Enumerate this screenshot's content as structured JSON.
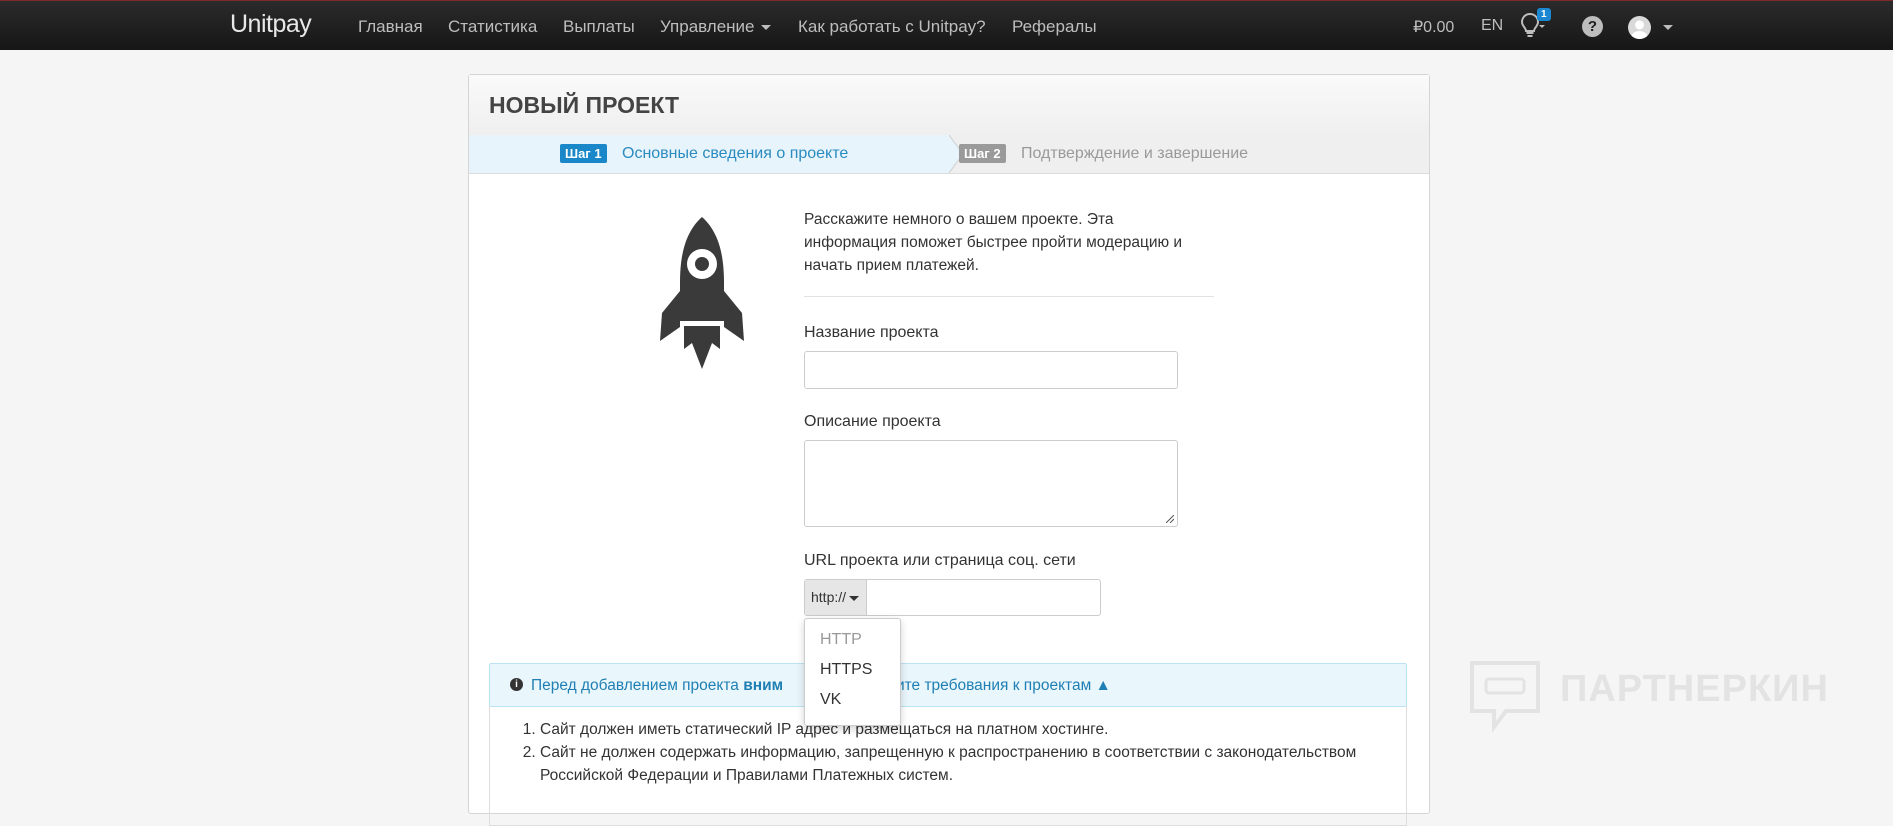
{
  "navbar": {
    "brand": "Unitpay",
    "items": [
      {
        "label": "Главная"
      },
      {
        "label": "Статистика"
      },
      {
        "label": "Выплаты"
      },
      {
        "label": "Управление"
      },
      {
        "label": "Как работать с Unitpay?"
      },
      {
        "label": "Рефералы"
      }
    ],
    "balance": "₽0.00",
    "language": "EN",
    "notifications_count": "1",
    "help_symbol": "?"
  },
  "page": {
    "title": "НОВЫЙ ПРОЕКТ",
    "steps": [
      {
        "badge": "Шаг 1",
        "label": "Основные сведения о проекте"
      },
      {
        "badge": "Шаг 2",
        "label": "Подтверждение и завершение"
      }
    ],
    "intro": "Расскажите немного о вашем проекте. Эта информация поможет быстрее пройти модерацию и начать прием платежей."
  },
  "form": {
    "name_label": "Название проекта",
    "name_value": "",
    "description_label": "Описание проекта",
    "description_value": "",
    "url_label": "URL проекта или страница соц. сети",
    "url_prefix": "http://",
    "url_value": "",
    "protocol_options": [
      "HTTP",
      "HTTPS",
      "VK"
    ]
  },
  "alert": {
    "text_before": "Перед добавлением проекта ",
    "text_bold": "вним",
    "text_after": "учите требования к проектам ▲"
  },
  "requirements": [
    "Сайт должен иметь статический IP адрес и размещаться на платном хостинге.",
    "Сайт не должен содержать информацию, запрещенную к распространению в соответствии с законодательством Российской Федерации и Правилами Платежных систем."
  ],
  "watermark": "ПАРТНЕРКИН",
  "colors": {
    "navbar": "#1e1e1e",
    "step_active_badge": "#1a87c9",
    "step_inactive_badge": "#9a9a9a",
    "step_active_text": "#2a8bc0",
    "alert_text": "#1f7fb4"
  }
}
